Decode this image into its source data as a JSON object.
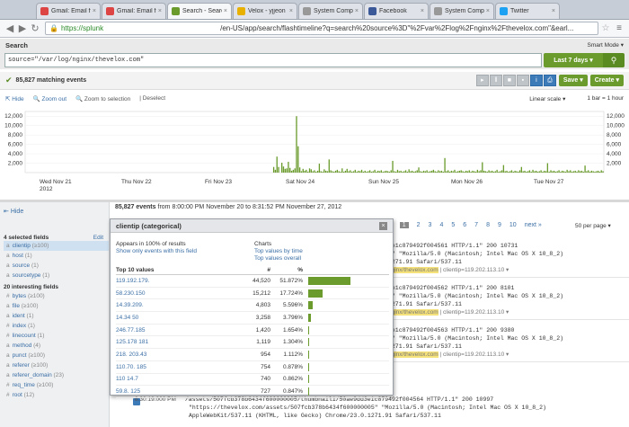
{
  "browser": {
    "tabs": [
      {
        "label": "Gmail: Email fr",
        "color": "#d44"
      },
      {
        "label": "Gmail: Email fr",
        "color": "#d44"
      },
      {
        "label": "Search - Search",
        "color": "#6a9b2c"
      },
      {
        "label": "Velox - yjjeon",
        "color": "#e8b000"
      },
      {
        "label": "System Compr",
        "color": "#999"
      },
      {
        "label": "Facebook",
        "color": "#3b5998"
      },
      {
        "label": "System Compr",
        "color": "#999"
      },
      {
        "label": "Twitter",
        "color": "#1da1f2"
      }
    ],
    "url_https": "https://splunk",
    "url_rest": "/en-US/app/search/flashtimeline?q=search%20source%3D\"%2Fvar%2Flog%2Fnginx%2Fthevelox.com\"&earl..."
  },
  "search": {
    "title": "Search",
    "mode": "Smart Mode",
    "query": "source=\"/var/log/nginx/thevelox.com\"",
    "time_range": "Last 7 days"
  },
  "status": {
    "matching": "85,827 matching events",
    "save_label": "Save",
    "create_label": "Create"
  },
  "timeline": {
    "hide": "Hide",
    "zoom_out": "Zoom out",
    "zoom_sel": "Zoom to selection",
    "deselect": "Deselect",
    "scale": "Linear scale",
    "bar": "1 bar = 1 hour"
  },
  "chart_data": {
    "type": "bar",
    "y_ticks": [
      "12,000",
      "10,000",
      "8,000",
      "6,000",
      "4,000",
      "2,000"
    ],
    "ylim": [
      0,
      13000
    ],
    "x_labels": [
      "Wed Nov 21",
      "2012",
      "Thu Nov 22",
      "Fri Nov 23",
      "Sat Nov 24",
      "Sun Nov 25",
      "Mon Nov 26",
      "Tue Nov 27"
    ],
    "values": [
      0,
      0,
      0,
      0,
      0,
      0,
      0,
      0,
      0,
      0,
      0,
      0,
      0,
      0,
      0,
      0,
      0,
      0,
      0,
      0,
      0,
      0,
      0,
      0,
      0,
      0,
      0,
      0,
      0,
      0,
      0,
      0,
      0,
      0,
      0,
      0,
      0,
      0,
      0,
      0,
      0,
      0,
      0,
      0,
      0,
      0,
      0,
      0,
      0,
      0,
      0,
      0,
      0,
      0,
      0,
      0,
      0,
      0,
      0,
      0,
      0,
      0,
      0,
      0,
      0,
      0,
      0,
      0,
      0,
      0,
      0,
      0,
      0,
      0,
      0,
      0,
      0,
      0,
      0,
      0,
      0,
      0,
      0,
      0,
      0,
      0,
      0,
      0,
      0,
      0,
      0,
      0,
      0,
      0,
      0,
      0,
      0,
      0,
      0,
      0,
      0,
      0,
      0,
      0,
      0,
      0,
      0,
      0,
      0,
      0,
      0,
      0,
      0,
      0,
      0,
      0,
      0,
      0,
      0,
      0,
      0,
      0,
      0,
      0,
      0,
      0,
      0,
      0,
      0,
      0,
      0,
      0,
      0,
      0,
      0,
      0,
      0,
      0,
      0,
      0,
      0,
      0,
      0,
      0,
      0,
      0,
      0,
      0,
      0,
      0,
      0,
      0,
      1200,
      600,
      3400,
      1200,
      0,
      2100,
      1300,
      800,
      900,
      2300,
      1000,
      400,
      600,
      900,
      12000,
      5600,
      1100,
      300,
      800,
      400,
      600,
      200,
      900,
      700,
      300,
      500,
      200,
      400,
      1900,
      300,
      200,
      700,
      400,
      300,
      2800,
      500,
      300,
      200,
      400,
      600,
      300,
      200,
      900,
      200,
      400,
      800,
      300,
      500,
      200,
      300,
      600,
      200,
      400,
      300,
      600,
      200,
      400,
      200,
      300,
      500,
      200,
      300,
      600,
      200,
      400,
      300,
      500,
      200,
      300,
      400,
      300,
      200,
      500,
      2500,
      300,
      200,
      600,
      300,
      400,
      200,
      300,
      500,
      200,
      700,
      300,
      400,
      200,
      300,
      500,
      1100,
      300,
      200,
      400,
      300,
      500,
      200,
      300,
      400,
      600,
      300,
      200,
      500,
      300,
      400,
      200,
      3100,
      300,
      500,
      200,
      400,
      300,
      600,
      200,
      300,
      400,
      500,
      300,
      200,
      400,
      300,
      500,
      200,
      400,
      300,
      200,
      600,
      300,
      500,
      2200,
      400,
      300,
      200,
      500,
      300,
      400,
      200,
      300,
      600,
      200,
      300,
      500,
      1600,
      300,
      400,
      200,
      300,
      500,
      200,
      400,
      300,
      200,
      500,
      1200,
      300,
      400,
      200,
      300,
      500,
      200,
      600,
      300,
      400,
      200,
      300,
      500,
      200,
      400,
      300,
      2000,
      200,
      500,
      300,
      400,
      200,
      300,
      500,
      200,
      400,
      300,
      200,
      600,
      300,
      500,
      200,
      300,
      400,
      200,
      500,
      300,
      400,
      200,
      1500,
      300,
      500,
      200,
      400,
      300,
      200,
      300,
      400,
      200,
      500,
      300
    ]
  },
  "results": {
    "count": "85,827 events",
    "range": "from 8:00:00 PM November 20 to 8:31:52 PM November 27, 2012",
    "pager": [
      "rev",
      "1",
      "2",
      "3",
      "4",
      "5",
      "6",
      "7",
      "8",
      "9",
      "10",
      "next »"
    ],
    "perpage": "50 per page"
  },
  "sidebar": {
    "hide": "Hide",
    "selected_head": "4 selected fields",
    "edit": "Edit",
    "selected": [
      {
        "type": "a",
        "name": "clientip",
        "count": "(≥100)"
      },
      {
        "type": "a",
        "name": "host",
        "count": "(1)"
      },
      {
        "type": "a",
        "name": "source",
        "count": "(1)"
      },
      {
        "type": "a",
        "name": "sourcetype",
        "count": "(1)"
      }
    ],
    "interesting_head": "20 interesting fields",
    "interesting": [
      {
        "type": "#",
        "name": "bytes",
        "count": "(≥100)"
      },
      {
        "type": "a",
        "name": "file",
        "count": "(≥100)"
      },
      {
        "type": "a",
        "name": "ident",
        "count": "(1)"
      },
      {
        "type": "#",
        "name": "index",
        "count": "(1)"
      },
      {
        "type": "#",
        "name": "linecount",
        "count": "(1)"
      },
      {
        "type": "a",
        "name": "method",
        "count": "(4)"
      },
      {
        "type": "a",
        "name": "punct",
        "count": "(≥100)"
      },
      {
        "type": "a",
        "name": "referer",
        "count": "(≥100)"
      },
      {
        "type": "a",
        "name": "referer_domain",
        "count": "(23)"
      },
      {
        "type": "#",
        "name": "req_time",
        "count": "(≥100)"
      },
      {
        "type": "#",
        "name": "root",
        "count": "(12)"
      }
    ]
  },
  "popup": {
    "title": "clientip (categorical)",
    "appears": "Appears in 100% of results",
    "show_only": "Show only events with this field",
    "charts_head": "Charts",
    "top_by_time": "Top values by time",
    "top_overall": "Top values overall",
    "col_values": "Top 10 values",
    "col_count": "#",
    "col_pct": "%",
    "rows": [
      {
        "v": "119.192.179.",
        "n": "44,520",
        "p": "51.872%",
        "f": 0.51872
      },
      {
        "v": "58.230.150",
        "n": "15,212",
        "p": "17.724%",
        "f": 0.17724
      },
      {
        "v": "14.39.209.",
        "n": "4,803",
        "p": "5.596%",
        "f": 0.05596
      },
      {
        "v": "14.34    50",
        "n": "3,258",
        "p": "3.796%",
        "f": 0.03796
      },
      {
        "v": "     246.77.185",
        "n": "1,420",
        "p": "1.654%",
        "f": 0.01654
      },
      {
        "v": "125.178     181",
        "n": "1,119",
        "p": "1.304%",
        "f": 0.01304
      },
      {
        "v": "218.     203.43",
        "n": "954",
        "p": "1.112%",
        "f": 0.01112
      },
      {
        "v": "110.70.     185",
        "n": "754",
        "p": "0.878%",
        "f": 0.00878
      },
      {
        "v": "110      14.7",
        "n": "740",
        "p": "0.862%",
        "f": 0.00862
      },
      {
        "v": "59.8.     125",
        "n": "727",
        "p": "0.847%",
        "f": 0.00847
      }
    ]
  },
  "events": [
    {
      "l1": "3e1c879492f004561 HTTP/1.1\" 200 10731",
      "l2": "5\" \"Mozilla/5.0 (Macintosh; Intel Mac OS X 10_8_2)",
      "l3": "1271.91 Safari/537.11",
      "l4a": "nginx/thevelox.com",
      "l4b": " | clientip=119.202.113.10"
    },
    {
      "l1": "3e1c879492f004562 HTTP/1.1\" 200 8101",
      "l2": "5\" \"Mozilla/5.0 (Macintosh; Intel Mac OS X 10_8_2)",
      "l3": "1271.91 Safari/537.11",
      "l4a": "nginx/thevelox.com",
      "l4b": " | clientip=119.202.113.10"
    },
    {
      "l1": "3e1c879492f004563 HTTP/1.1\" 200 9380",
      "l2": "5\" \"Mozilla/5.0 (Macintosh; Intel Mac OS X 10_8_2)",
      "l3": "1271.91 Safari/537.11",
      "l4a": "nginx/thevelox.com",
      "l4b": " | clientip=119.202.113.10"
    }
  ],
  "event_bottom": {
    "time": "8:30:19.000 PM",
    "l1": "/assets/507fcb378b6434f600000005/thumbnail1/50ae9dd3e1c879492f004564 HTTP/1.1\" 200 10997",
    "l2": "\"https://thevelox.com/assets/507fcb378b6434f600000005\" \"Mozilla/5.0 (Macintosh; Intel Mac OS X 10_8_2)",
    "l3": "AppleWebKit/537.11 (KHTML, like Gecko) Chrome/23.0.1271.91 Safari/537.11"
  }
}
